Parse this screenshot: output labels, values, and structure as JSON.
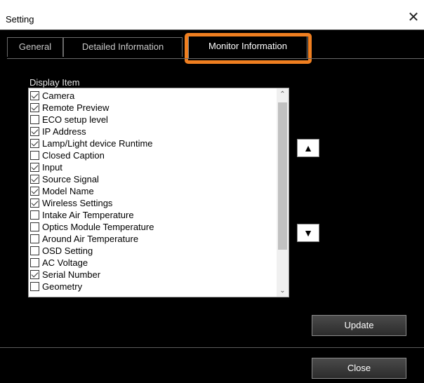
{
  "window": {
    "title": "Setting",
    "close_glyph": "✕"
  },
  "tabs": [
    {
      "label": "General"
    },
    {
      "label": "Detailed Information"
    },
    {
      "label": "Monitor Information"
    }
  ],
  "active_tab": "Monitor Information",
  "highlight_color": "#f07f20",
  "display_item": {
    "label": "Display Item",
    "items": [
      {
        "label": "Camera",
        "checked": true
      },
      {
        "label": "Remote Preview",
        "checked": true
      },
      {
        "label": "ECO setup level",
        "checked": false
      },
      {
        "label": "IP Address",
        "checked": true
      },
      {
        "label": "Lamp/Light device Runtime",
        "checked": true
      },
      {
        "label": "Closed Caption",
        "checked": false
      },
      {
        "label": "Input",
        "checked": true
      },
      {
        "label": "Source Signal",
        "checked": true
      },
      {
        "label": "Model Name",
        "checked": true
      },
      {
        "label": "Wireless Settings",
        "checked": true
      },
      {
        "label": "Intake Air Temperature",
        "checked": false
      },
      {
        "label": "Optics Module Temperature",
        "checked": false
      },
      {
        "label": "Around Air Temperature",
        "checked": false
      },
      {
        "label": "OSD Setting",
        "checked": false
      },
      {
        "label": "AC Voltage",
        "checked": false
      },
      {
        "label": "Serial Number",
        "checked": true
      },
      {
        "label": "Geometry",
        "checked": false
      }
    ]
  },
  "buttons": {
    "move_up": "▲",
    "move_down": "▼",
    "update": "Update",
    "close": "Close"
  }
}
